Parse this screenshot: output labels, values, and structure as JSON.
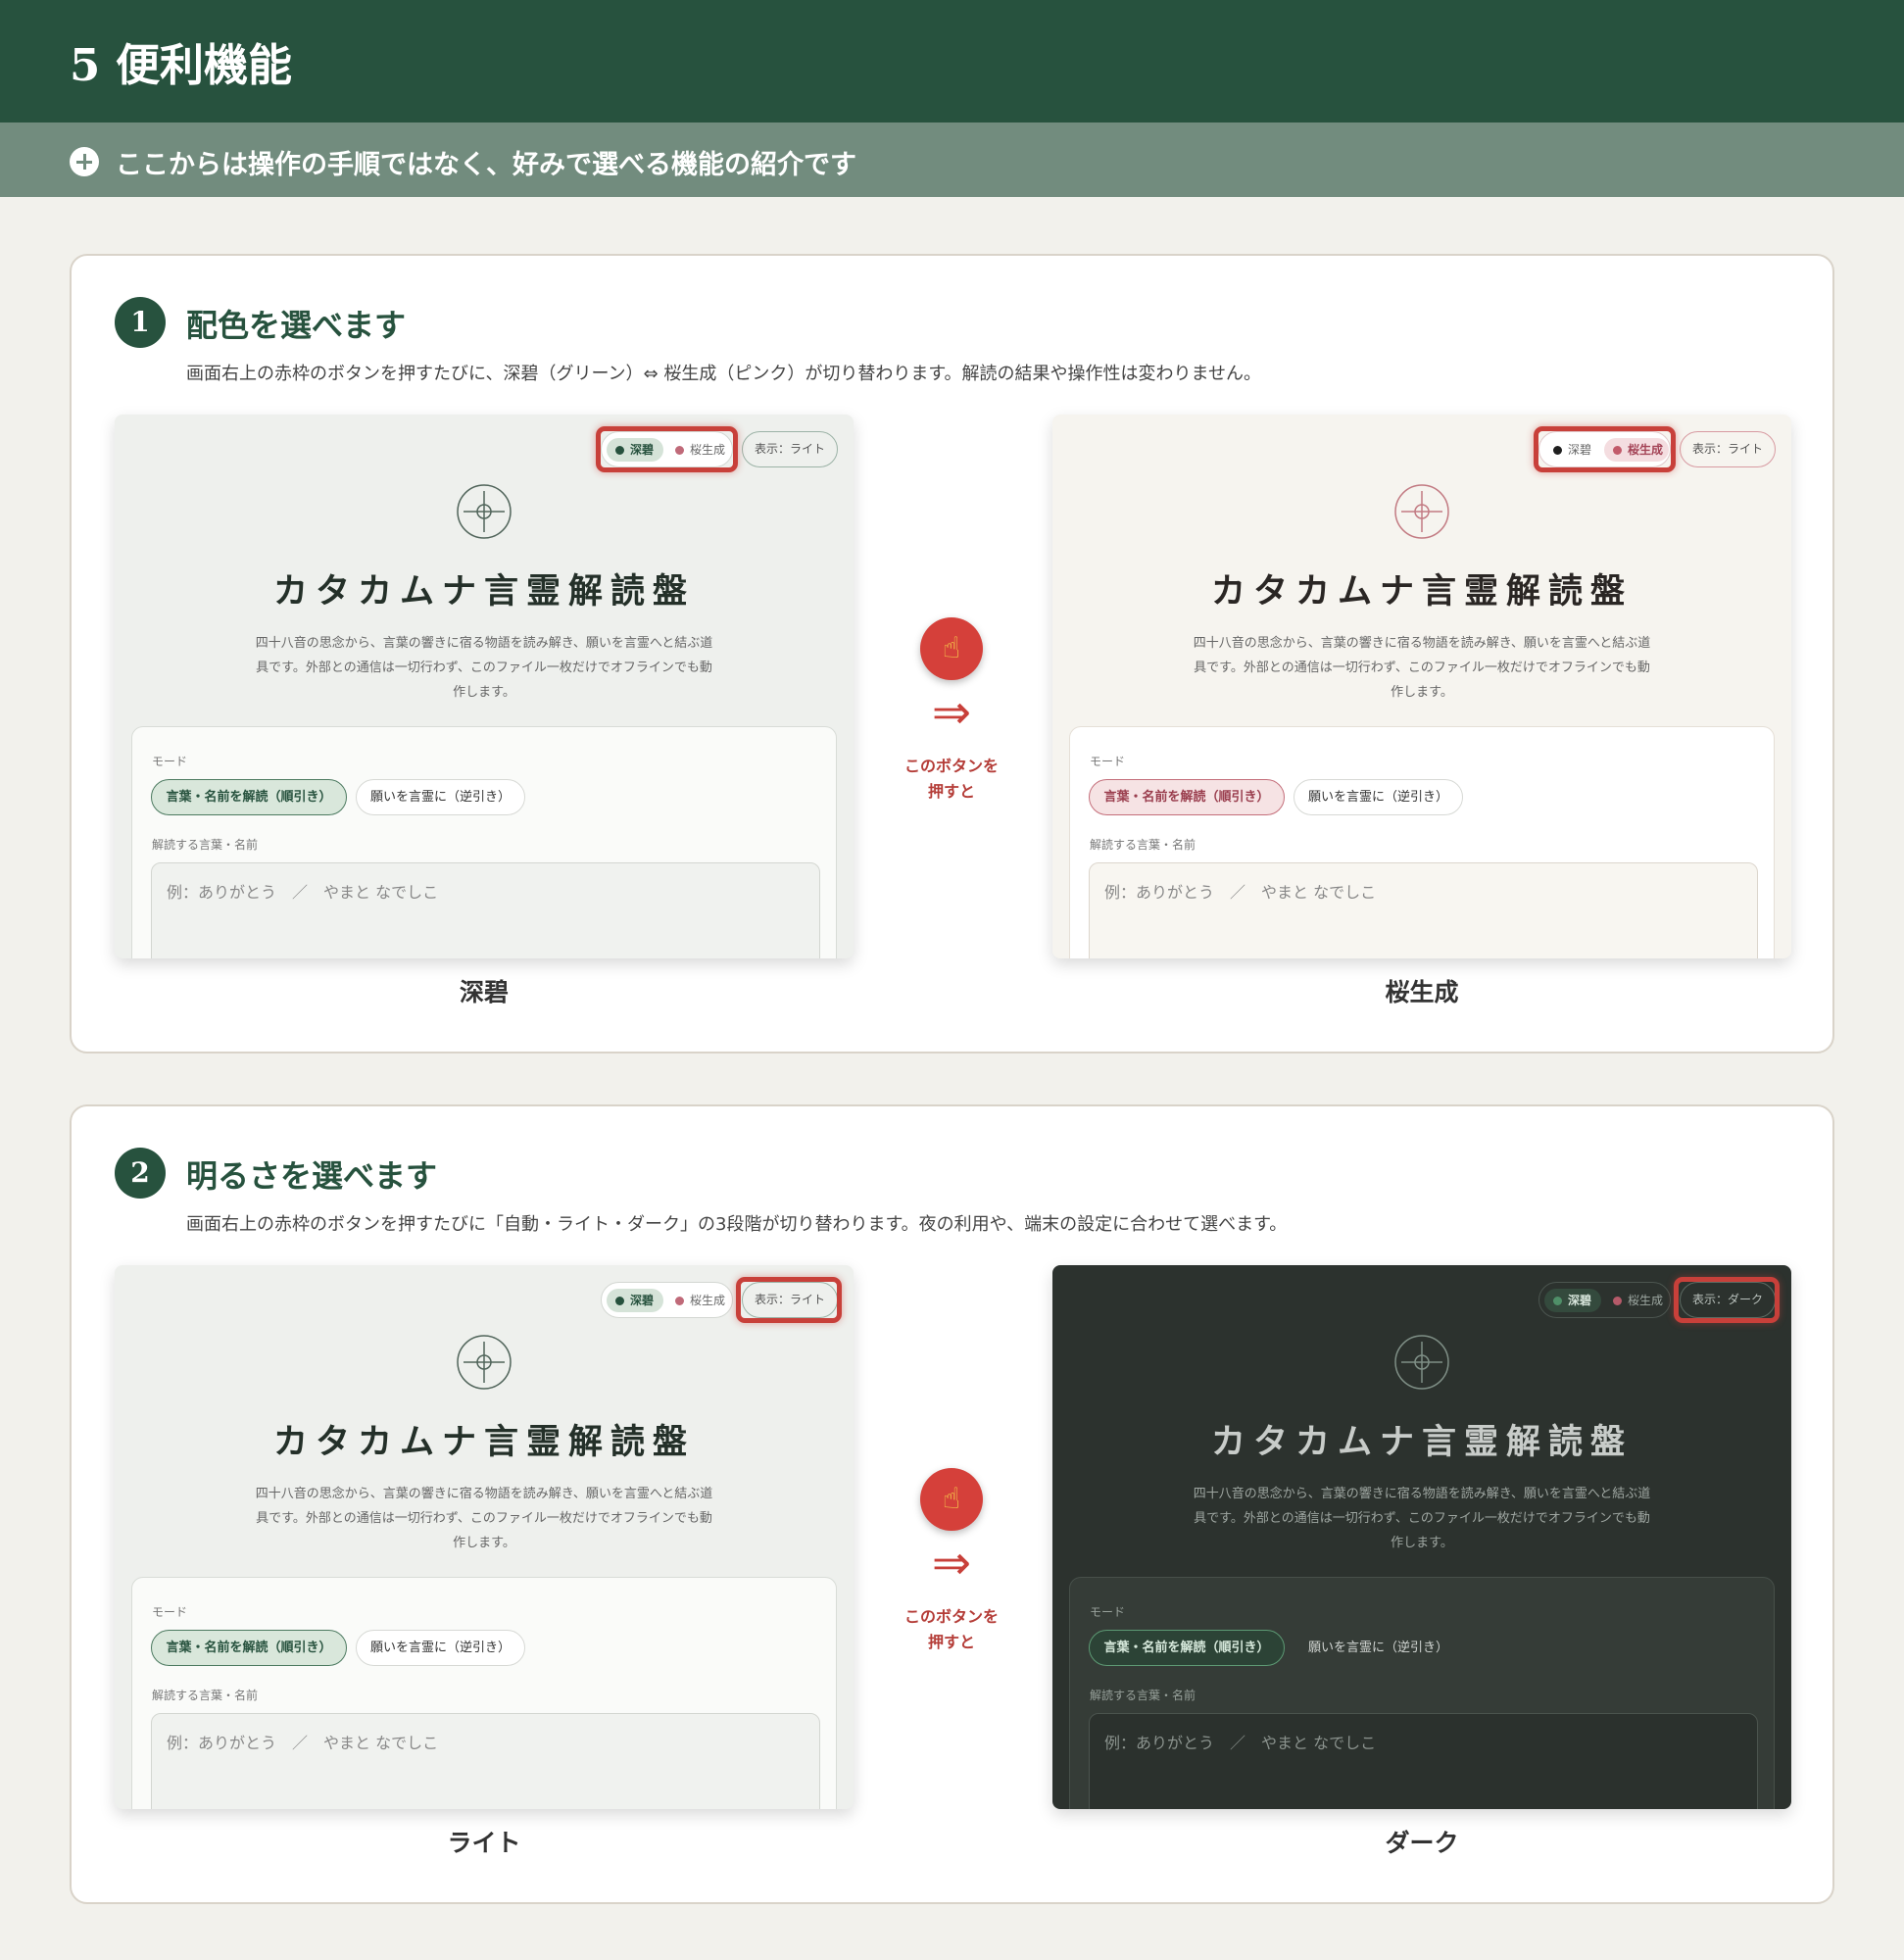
{
  "header": {
    "title": "5 便利機能",
    "subtitle": "ここからは操作の手順ではなく、好みで選べる機能の紹介です"
  },
  "sections": [
    {
      "number": "1",
      "title": "配色を選べます",
      "description": "画面右上の赤枠のボタンを押すたびに、深碧（グリーン）⇔ 桜生成（ピンク）が切り替わります。解読の結果や操作性は変わりません。",
      "arrow": {
        "icon": "pointing-hand",
        "text_line1": "このボタンを",
        "text_line2": "押すと"
      },
      "screens": [
        {
          "caption": "深碧",
          "theme": "green",
          "mode": "light",
          "highlight": "color-switch"
        },
        {
          "caption": "桜生成",
          "theme": "sakura",
          "mode": "light",
          "highlight": "color-switch"
        }
      ]
    },
    {
      "number": "2",
      "title": "明るさを選べます",
      "description": "画面右上の赤枠のボタンを押すたびに「自動・ライト・ダーク」の3段階が切り替わります。夜の利用や、端末の設定に合わせて選べます。",
      "arrow": {
        "icon": "pointing-hand",
        "text_line1": "このボタンを",
        "text_line2": "押すと"
      },
      "screens": [
        {
          "caption": "ライト",
          "theme": "green",
          "mode": "light",
          "highlight": "display-button"
        },
        {
          "caption": "ダーク",
          "theme": "green",
          "mode": "dark",
          "highlight": "display-button"
        }
      ]
    }
  ],
  "app": {
    "switch": {
      "option1": "深碧",
      "option2": "桜生成"
    },
    "display_light": "表示：ライト",
    "display_dark": "表示：ダーク",
    "title": "カタカムナ言霊解読盤",
    "description": "四十八音の思念から、言葉の響きに宿る物語を読み解き、願いを言霊へと結ぶ道具です。外部との通信は一切行わず、このファイル一枚だけでオフラインでも動作します。",
    "mode_label": "モード",
    "mode_forward": "言葉・名前を解読（順引き）",
    "mode_reverse": "願いを言霊に（逆引き）",
    "input_label": "解読する言葉・名前",
    "input_placeholder": "例：ありがとう　／　やまと なでしこ"
  },
  "colors": {
    "header_bg": "#27523e",
    "subheader_bg": "#728c7e",
    "accent_red": "#c8403a",
    "page_bg": "#f2f1ec"
  }
}
